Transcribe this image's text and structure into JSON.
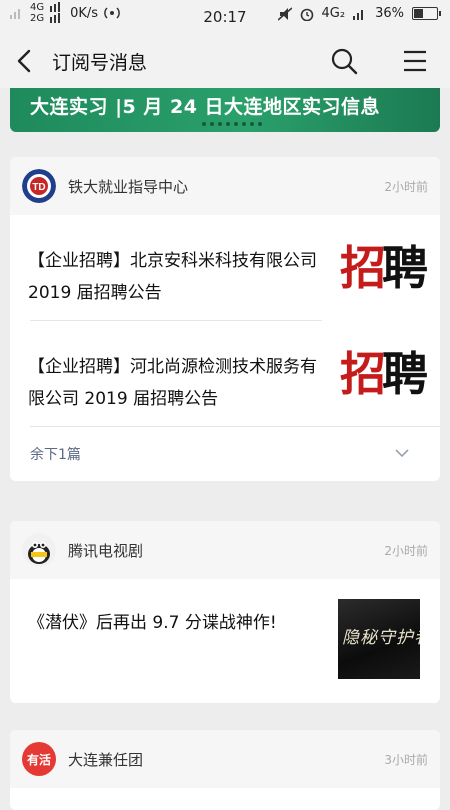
{
  "status_bar": {
    "net_top": "4G",
    "net_bottom": "2G",
    "speed": "0K/s",
    "time": "20:17",
    "net_right": "4G₂",
    "battery": "36%",
    "battery_level": 0.36
  },
  "nav": {
    "title": "订阅号消息"
  },
  "banner": {
    "text": "大连实习 |5 月 24 日大连地区实习信息"
  },
  "cards": [
    {
      "source": "铁大就业指导中心",
      "time": "2小时前",
      "articles": [
        {
          "title": "【企业招聘】北京安科米科技有限公司 2019 届招聘公告",
          "thumb": "招聘"
        },
        {
          "title": "【企业招聘】河北尚源检测技术服务有限公司 2019 届招聘公告",
          "thumb": "招聘"
        }
      ],
      "more": "余下1篇"
    },
    {
      "source": "腾讯电视剧",
      "time": "2小时前",
      "articles": [
        {
          "title": "《潜伏》后再出 9.7 分谍战神作!",
          "thumb": "隐秘守护者"
        }
      ]
    },
    {
      "source": "大连兼任团",
      "time": "3小时前",
      "avatar_text": "有活"
    }
  ],
  "colors": {
    "banner": "#2aa06b",
    "link": "#5b6b84",
    "accent_red": "#c41b1b"
  }
}
